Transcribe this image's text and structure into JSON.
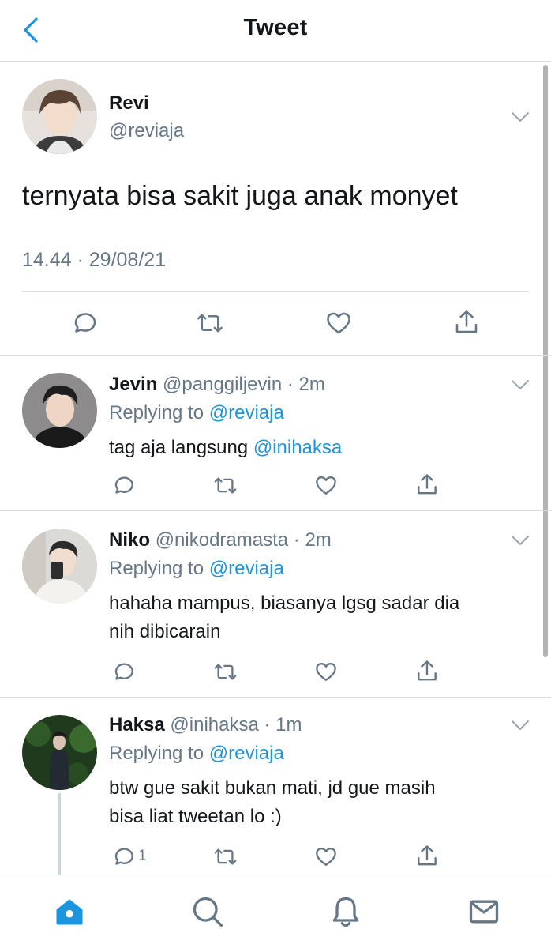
{
  "header": {
    "title": "Tweet",
    "back_icon": "chevron-left-icon"
  },
  "colors": {
    "accent": "#1b95e0",
    "text": "#14171a",
    "muted": "#657786",
    "divider": "#d9dde0"
  },
  "main_tweet": {
    "name": "Revi",
    "handle": "@reviaja",
    "text": "ternyata bisa sakit juga anak monyet",
    "timestamp": "14.44 · 29/08/21",
    "actions": [
      "reply-icon",
      "retweet-icon",
      "like-icon",
      "share-icon"
    ]
  },
  "replies": [
    {
      "name": "Jevin",
      "handle": "@panggiljevin · 2m",
      "replying_prefix": "Replying to ",
      "replying_to": "@reviaja",
      "text": "tag aja langsung ",
      "mention": "@inihaksa",
      "reply_count": ""
    },
    {
      "name": "Niko",
      "handle": "@nikodramasta · 2m",
      "replying_prefix": "Replying to ",
      "replying_to": "@reviaja",
      "text_line1": "hahaha mampus, biasanya lgsg sadar dia",
      "text_line2": "nih dibicarain",
      "reply_count": ""
    },
    {
      "name": "Haksa",
      "handle": "@inihaksa · 1m",
      "replying_prefix": "Replying to ",
      "replying_to": "@reviaja",
      "text_line1": "btw gue sakit bukan mati, jd gue masih",
      "text_line2": "bisa liat tweetan lo :)",
      "reply_count": "1"
    }
  ],
  "tabbar": {
    "items": [
      "home-icon",
      "search-icon",
      "notifications-icon",
      "messages-icon"
    ],
    "active": "home-icon"
  }
}
